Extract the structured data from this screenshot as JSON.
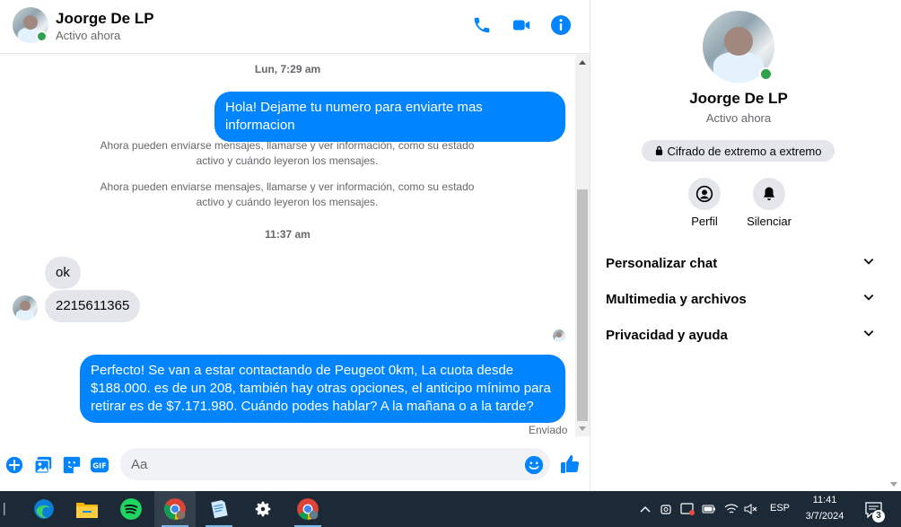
{
  "chat": {
    "contact_name": "Joorge De LP",
    "contact_status": "Activo ahora"
  },
  "messages": {
    "time_1": "Lun, 7:29 am",
    "out_1": "Hola! Dejame tu numero para enviarte mas informacion",
    "sys_1": "Ahora pueden enviarse mensajes, llamarse y ver información, como su estado activo y cuándo leyeron los mensajes.",
    "sys_2": "Ahora pueden enviarse mensajes, llamarse y ver información, como su estado activo y cuándo leyeron los mensajes.",
    "time_2": "11:37 am",
    "in_1": "ok",
    "in_2": "2215611365",
    "out_2": "Perfecto!  Se van a estar contactando de Peugeot 0km, La cuota desde $188.000. es de un 208, también hay otras opciones, el anticipo mínimo para retirar es de $7.171.980. Cuándo podes hablar? A la mañana o a la tarde?",
    "sent_status": "Enviado"
  },
  "composer": {
    "placeholder": "Aa"
  },
  "info_panel": {
    "name": "Joorge De LP",
    "status": "Activo ahora",
    "e2e_label": "Cifrado de extremo a extremo",
    "profile_label": "Perfil",
    "mute_label": "Silenciar",
    "sections": [
      {
        "label": "Personalizar chat"
      },
      {
        "label": "Multimedia y archivos"
      },
      {
        "label": "Privacidad y ayuda"
      }
    ]
  },
  "taskbar": {
    "language": "ESP",
    "time": "11:41",
    "date": "3/7/2024",
    "notification_count": "3"
  },
  "colors": {
    "accent": "#0084ff",
    "online": "#31a24c",
    "taskbar": "#1c2a38"
  }
}
